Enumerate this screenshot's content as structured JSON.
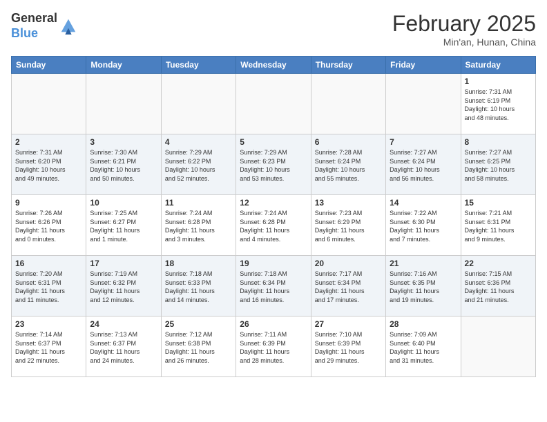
{
  "header": {
    "logo_general": "General",
    "logo_blue": "Blue",
    "month_title": "February 2025",
    "location": "Min'an, Hunan, China"
  },
  "days_of_week": [
    "Sunday",
    "Monday",
    "Tuesday",
    "Wednesday",
    "Thursday",
    "Friday",
    "Saturday"
  ],
  "weeks": [
    [
      {
        "day": "",
        "info": ""
      },
      {
        "day": "",
        "info": ""
      },
      {
        "day": "",
        "info": ""
      },
      {
        "day": "",
        "info": ""
      },
      {
        "day": "",
        "info": ""
      },
      {
        "day": "",
        "info": ""
      },
      {
        "day": "1",
        "info": "Sunrise: 7:31 AM\nSunset: 6:19 PM\nDaylight: 10 hours\nand 48 minutes."
      }
    ],
    [
      {
        "day": "2",
        "info": "Sunrise: 7:31 AM\nSunset: 6:20 PM\nDaylight: 10 hours\nand 49 minutes."
      },
      {
        "day": "3",
        "info": "Sunrise: 7:30 AM\nSunset: 6:21 PM\nDaylight: 10 hours\nand 50 minutes."
      },
      {
        "day": "4",
        "info": "Sunrise: 7:29 AM\nSunset: 6:22 PM\nDaylight: 10 hours\nand 52 minutes."
      },
      {
        "day": "5",
        "info": "Sunrise: 7:29 AM\nSunset: 6:23 PM\nDaylight: 10 hours\nand 53 minutes."
      },
      {
        "day": "6",
        "info": "Sunrise: 7:28 AM\nSunset: 6:24 PM\nDaylight: 10 hours\nand 55 minutes."
      },
      {
        "day": "7",
        "info": "Sunrise: 7:27 AM\nSunset: 6:24 PM\nDaylight: 10 hours\nand 56 minutes."
      },
      {
        "day": "8",
        "info": "Sunrise: 7:27 AM\nSunset: 6:25 PM\nDaylight: 10 hours\nand 58 minutes."
      }
    ],
    [
      {
        "day": "9",
        "info": "Sunrise: 7:26 AM\nSunset: 6:26 PM\nDaylight: 11 hours\nand 0 minutes."
      },
      {
        "day": "10",
        "info": "Sunrise: 7:25 AM\nSunset: 6:27 PM\nDaylight: 11 hours\nand 1 minute."
      },
      {
        "day": "11",
        "info": "Sunrise: 7:24 AM\nSunset: 6:28 PM\nDaylight: 11 hours\nand 3 minutes."
      },
      {
        "day": "12",
        "info": "Sunrise: 7:24 AM\nSunset: 6:28 PM\nDaylight: 11 hours\nand 4 minutes."
      },
      {
        "day": "13",
        "info": "Sunrise: 7:23 AM\nSunset: 6:29 PM\nDaylight: 11 hours\nand 6 minutes."
      },
      {
        "day": "14",
        "info": "Sunrise: 7:22 AM\nSunset: 6:30 PM\nDaylight: 11 hours\nand 7 minutes."
      },
      {
        "day": "15",
        "info": "Sunrise: 7:21 AM\nSunset: 6:31 PM\nDaylight: 11 hours\nand 9 minutes."
      }
    ],
    [
      {
        "day": "16",
        "info": "Sunrise: 7:20 AM\nSunset: 6:31 PM\nDaylight: 11 hours\nand 11 minutes."
      },
      {
        "day": "17",
        "info": "Sunrise: 7:19 AM\nSunset: 6:32 PM\nDaylight: 11 hours\nand 12 minutes."
      },
      {
        "day": "18",
        "info": "Sunrise: 7:18 AM\nSunset: 6:33 PM\nDaylight: 11 hours\nand 14 minutes."
      },
      {
        "day": "19",
        "info": "Sunrise: 7:18 AM\nSunset: 6:34 PM\nDaylight: 11 hours\nand 16 minutes."
      },
      {
        "day": "20",
        "info": "Sunrise: 7:17 AM\nSunset: 6:34 PM\nDaylight: 11 hours\nand 17 minutes."
      },
      {
        "day": "21",
        "info": "Sunrise: 7:16 AM\nSunset: 6:35 PM\nDaylight: 11 hours\nand 19 minutes."
      },
      {
        "day": "22",
        "info": "Sunrise: 7:15 AM\nSunset: 6:36 PM\nDaylight: 11 hours\nand 21 minutes."
      }
    ],
    [
      {
        "day": "23",
        "info": "Sunrise: 7:14 AM\nSunset: 6:37 PM\nDaylight: 11 hours\nand 22 minutes."
      },
      {
        "day": "24",
        "info": "Sunrise: 7:13 AM\nSunset: 6:37 PM\nDaylight: 11 hours\nand 24 minutes."
      },
      {
        "day": "25",
        "info": "Sunrise: 7:12 AM\nSunset: 6:38 PM\nDaylight: 11 hours\nand 26 minutes."
      },
      {
        "day": "26",
        "info": "Sunrise: 7:11 AM\nSunset: 6:39 PM\nDaylight: 11 hours\nand 28 minutes."
      },
      {
        "day": "27",
        "info": "Sunrise: 7:10 AM\nSunset: 6:39 PM\nDaylight: 11 hours\nand 29 minutes."
      },
      {
        "day": "28",
        "info": "Sunrise: 7:09 AM\nSunset: 6:40 PM\nDaylight: 11 hours\nand 31 minutes."
      },
      {
        "day": "",
        "info": ""
      }
    ]
  ]
}
